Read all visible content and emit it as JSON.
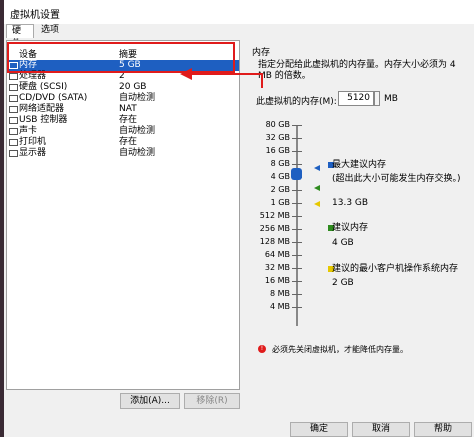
{
  "window": {
    "title": "虚拟机设置"
  },
  "tabs": [
    {
      "label": "硬件"
    },
    {
      "label": "选项"
    }
  ],
  "device_list": {
    "col_device": "设备",
    "col_summary": "摘要",
    "rows": [
      {
        "name": "内存",
        "summary": "5 GB",
        "icon": "memory-icon"
      },
      {
        "name": "处理器",
        "summary": "2",
        "icon": "processor-icon"
      },
      {
        "name": "硬盘 (SCSI)",
        "summary": "20 GB",
        "icon": "hard-disk-icon"
      },
      {
        "name": "CD/DVD (SATA)",
        "summary": "自动检测",
        "icon": "cd-dvd-icon"
      },
      {
        "name": "网络适配器",
        "summary": "NAT",
        "icon": "network-adapter-icon"
      },
      {
        "name": "USB 控制器",
        "summary": "存在",
        "icon": "usb-controller-icon"
      },
      {
        "name": "声卡",
        "summary": "自动检测",
        "icon": "sound-card-icon"
      },
      {
        "name": "打印机",
        "summary": "存在",
        "icon": "printer-icon"
      },
      {
        "name": "显示器",
        "summary": "自动检测",
        "icon": "display-icon"
      }
    ]
  },
  "buttons": {
    "add": "添加(A)...",
    "remove": "移除(R)"
  },
  "memory": {
    "section_title": "内存",
    "description": "指定分配给此虚拟机的内存量。内存大小必须为 4 MB 的倍数。",
    "label": "此虚拟机的内存(M):",
    "value": "5120",
    "unit": "MB",
    "scale_labels": [
      "80 GB",
      "32 GB",
      "16 GB",
      "8 GB",
      "4 GB",
      "2 GB",
      "1 GB",
      "512 MB",
      "256 MB",
      "128 MB",
      "64 MB",
      "32 MB",
      "16 MB",
      "8 MB",
      "4 MB"
    ],
    "max": {
      "title": "最大建议内存",
      "note": "(超出此大小可能发生内存交换。)",
      "value": "13.3 GB",
      "color": "#1e5fc1"
    },
    "recommended": {
      "title": "建议内存",
      "value": "4 GB",
      "color": "#2e8b1e"
    },
    "min_guest": {
      "title": "建议的最小客户机操作系统内存",
      "value": "2 GB",
      "color": "#e6c800"
    },
    "warning": "必须先关闭虚拟机，才能降低内存量。"
  },
  "footer": {
    "ok": "确定",
    "cancel": "取消",
    "help": "帮助"
  }
}
